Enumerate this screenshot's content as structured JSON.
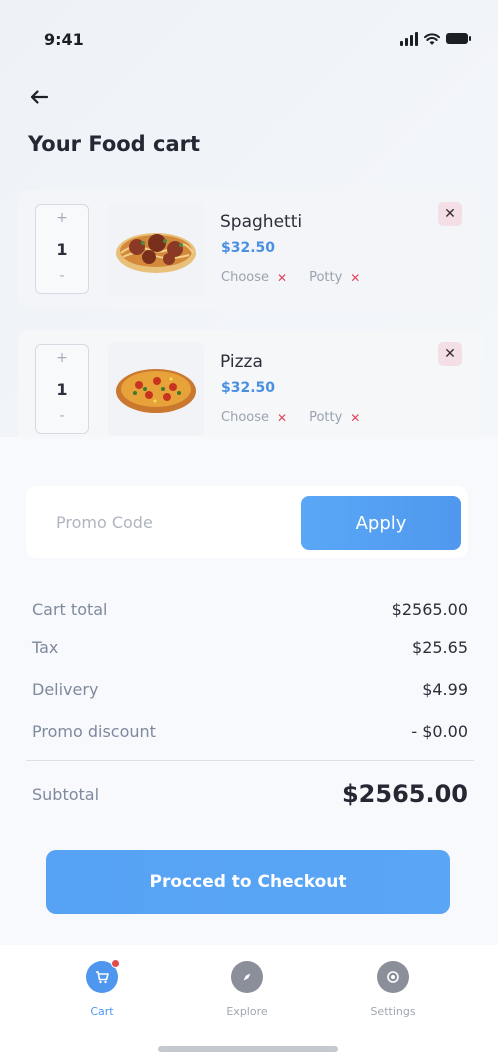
{
  "status_bar": {
    "time": "9:41"
  },
  "header": {
    "title": "Your Food cart"
  },
  "cart_items": [
    {
      "name": "Spaghetti",
      "price": "$32.50",
      "quantity": "1",
      "plus": "+",
      "minus": "-",
      "tags": [
        "Choose",
        "Potty"
      ],
      "remove": "✕",
      "image_icon": "spaghetti-meatballs"
    },
    {
      "name": "Pizza",
      "price": "$32.50",
      "quantity": "1",
      "plus": "+",
      "minus": "-",
      "tags": [
        "Choose",
        "Potty"
      ],
      "remove": "✕",
      "image_icon": "pizza"
    }
  ],
  "promo": {
    "placeholder": "Promo Code",
    "apply_label": "Apply"
  },
  "summary": {
    "cart_total_label": "Cart total",
    "cart_total_value": "$2565.00",
    "tax_label": "Tax",
    "tax_value": "$25.65",
    "delivery_label": "Delivery",
    "delivery_value": "$4.99",
    "promo_discount_label": "Promo discount",
    "promo_discount_value": "- $0.00",
    "subtotal_label": "Subtotal",
    "subtotal_value": "$2565.00"
  },
  "checkout": {
    "label": "Procced to Checkout"
  },
  "bottom_nav": [
    {
      "label": "Cart",
      "icon": "cart-icon",
      "active": true
    },
    {
      "label": "Explore",
      "icon": "compass-icon",
      "active": false
    },
    {
      "label": "Settings",
      "icon": "gear-icon",
      "active": false
    }
  ],
  "colors": {
    "accent": "#4f97ee",
    "price": "#4a90e2",
    "remove_bg": "#f4dfe6",
    "tag_x": "#e0455f"
  }
}
